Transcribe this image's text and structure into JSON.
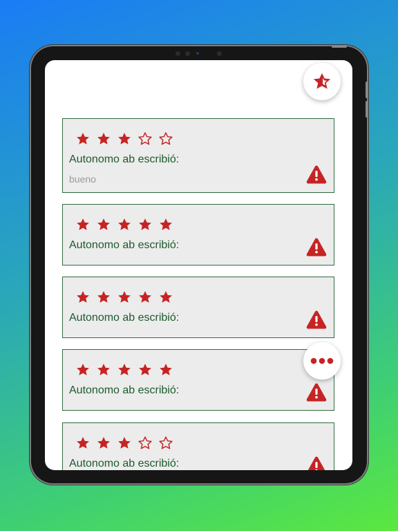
{
  "colors": {
    "star": "#c62424",
    "accent_red": "#c62424",
    "card_border": "#2f6b3e",
    "text_green": "#1d5a2d",
    "comment_gray": "#9a9a9a",
    "card_bg": "#ececec"
  },
  "icons": {
    "rate_button": "star-half-icon",
    "more_button": "more-horizontal-icon",
    "report": "warning-icon"
  },
  "reviews": [
    {
      "rating": 3,
      "max_rating": 5,
      "author_text": "Autonomo ab escribió:",
      "comment": "bueno"
    },
    {
      "rating": 5,
      "max_rating": 5,
      "author_text": "Autonomo ab escribió:",
      "comment": ""
    },
    {
      "rating": 5,
      "max_rating": 5,
      "author_text": "Autonomo ab escribió:",
      "comment": ""
    },
    {
      "rating": 5,
      "max_rating": 5,
      "author_text": "Autonomo ab escribió:",
      "comment": ""
    },
    {
      "rating": 3,
      "max_rating": 5,
      "author_text": "Autonomo ab escribió:",
      "comment": ""
    }
  ]
}
